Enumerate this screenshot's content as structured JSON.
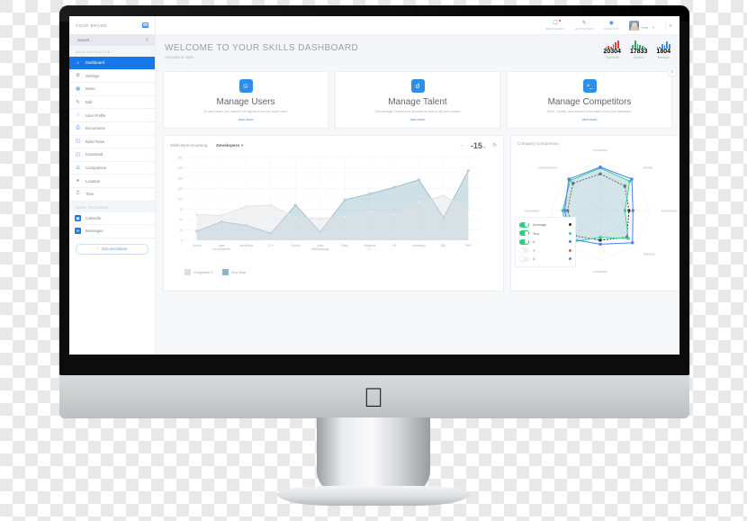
{
  "sidebar": {
    "brand": "YOUR BRAND",
    "burger_icon": "hamburger-icon",
    "search": {
      "placeholder": "Search...",
      "value": "",
      "icon": "search-icon"
    },
    "section_main": "MAIN NAVIGATION",
    "section_core": "CORE FEATURES",
    "items": [
      {
        "label": "Dashboard",
        "icon": "home-icon",
        "chevron": "",
        "active": true
      },
      {
        "label": "Settings",
        "icon": "gear-icon",
        "chevron": "›"
      },
      {
        "label": "Menu",
        "icon": "grid-icon",
        "chevron": "›"
      },
      {
        "label": "Edit",
        "icon": "pencil-icon",
        "chevron": "›"
      },
      {
        "label": "User Profile",
        "icon": "user-icon",
        "chevron": "›"
      },
      {
        "label": "Documents",
        "icon": "document-icon",
        "chevron": "›"
      },
      {
        "label": "Build Team",
        "icon": "briefcase-icon",
        "chevron": "›"
      },
      {
        "label": "Download",
        "icon": "folder-icon",
        "chevron": "›"
      },
      {
        "label": "Comparison",
        "icon": "list-icon",
        "chevron": "›"
      },
      {
        "label": "Location",
        "icon": "pin-icon",
        "chevron": ""
      },
      {
        "label": "Time",
        "icon": "clock-icon",
        "chevron": ""
      }
    ],
    "core_items": [
      {
        "label": "Calendar",
        "icon": "calendar-icon"
      },
      {
        "label": "Messages",
        "icon": "mail-icon"
      }
    ],
    "documentation": {
      "label": "Documentation",
      "icon": "info-icon"
    }
  },
  "topbar": {
    "items": [
      {
        "label": "MESSAGES",
        "icon": "message-icon",
        "badge": true
      },
      {
        "label": "ACTIVITIES",
        "icon": "activity-icon",
        "badge": false
      },
      {
        "label": "ENGLISH",
        "icon": "globe-icon",
        "badge": false
      }
    ],
    "user": {
      "name": "Peter",
      "avatar": "avatar",
      "caret": "▾"
    },
    "panel_toggle": "◂"
  },
  "welcome": {
    "title": "WELCOME TO YOUR SKILLS DASHBOARD",
    "subtitle": "overview & stats",
    "stats": [
      {
        "value": "20304",
        "label": "Total Skills",
        "color": "#e8413a",
        "bars": [
          20,
          35,
          25,
          55,
          75,
          100
        ]
      },
      {
        "value": "17833",
        "label": "Experts",
        "color": "#2fa86a",
        "bars": [
          45,
          95,
          60,
          40,
          30,
          20
        ]
      },
      {
        "value": "1804",
        "label": "Meetings",
        "color": "#3f8fe0",
        "bars": [
          25,
          20,
          55,
          40,
          85,
          60
        ]
      }
    ]
  },
  "cards": [
    {
      "icon": "users-icon",
      "glyph": "☺",
      "title": "Manage Users",
      "desc": "To add users, you need to be signed in as the super user.",
      "more": "view more"
    },
    {
      "icon": "link-icon",
      "glyph": "ὑ7",
      "title": "Manage Talent",
      "desc": "The Manage Orders tool provides a view of all your orders.",
      "more": "view more"
    },
    {
      "icon": "terminal-icon",
      "glyph": ">_",
      "title": "Manage Competitors",
      "desc": "Store, modify, and extract information from your database.",
      "more": "view more"
    }
  ],
  "gear_float": "gear-icon",
  "chart_data": [
    {
      "type": "area",
      "title": "Skills Benchmarking",
      "filter": "Developers +",
      "delta_value": "-15",
      "delta_unit": "%",
      "minus_icon": "minus-icon",
      "refresh_icon": "refresh-icon",
      "xlabel": "",
      "ylabel": "",
      "ylim": [
        0,
        200
      ],
      "yticks": [
        200,
        175,
        150,
        125,
        100,
        75,
        50,
        25,
        0
      ],
      "grid": true,
      "categories": [
        "Scrum",
        "Agile Development",
        "JavaScript",
        "C++",
        "Python",
        "Lean Methodology",
        "Ruby",
        "Objective C",
        "C#",
        "Assembly",
        "SQL",
        "PHP"
      ],
      "series": [
        {
          "name": "Competitor X",
          "color": "#dddfe2",
          "values": [
            62,
            60,
            82,
            85,
            56,
            53,
            58,
            70,
            62,
            93,
            108,
            73
          ]
        },
        {
          "name": "Your Data",
          "color": "#8fb4c6",
          "values": [
            22,
            45,
            36,
            17,
            85,
            20,
            98,
            112,
            128,
            146,
            55,
            168
          ]
        }
      ],
      "legend": [
        {
          "label": "Competitor X",
          "color": "#dddfe2"
        },
        {
          "label": "Your Data",
          "color": "#8fb4c6"
        }
      ]
    },
    {
      "type": "radar",
      "title": "Company Comparison",
      "axes": [
        "Innovation",
        "Mobile",
        "Development",
        "Startups",
        "Innovation",
        "Development",
        "Innovation",
        "Development"
      ],
      "max": 100,
      "series": [
        {
          "name": "Average",
          "color": "#2b2b2b",
          "values": [
            74,
            70,
            58,
            76,
            60,
            72,
            66,
            78
          ]
        },
        {
          "name": "You",
          "color": "#2fd19a",
          "values": [
            86,
            84,
            50,
            80,
            54,
            92,
            76,
            86
          ]
        },
        {
          "name": "X",
          "color": "#4a7ef0",
          "values": [
            88,
            90,
            66,
            92,
            68,
            82,
            72,
            90
          ]
        }
      ],
      "toggles": [
        {
          "label": "Average",
          "on": true,
          "dot": "#2b2b2b"
        },
        {
          "label": "You",
          "on": true,
          "dot": "#2fd19a"
        },
        {
          "label": "X",
          "on": true,
          "dot": "#4a7ef0"
        },
        {
          "label": "Y",
          "on": false,
          "dot": "#e8613a"
        },
        {
          "label": "Z",
          "on": false,
          "dot": "#6f7bd8"
        }
      ]
    }
  ]
}
